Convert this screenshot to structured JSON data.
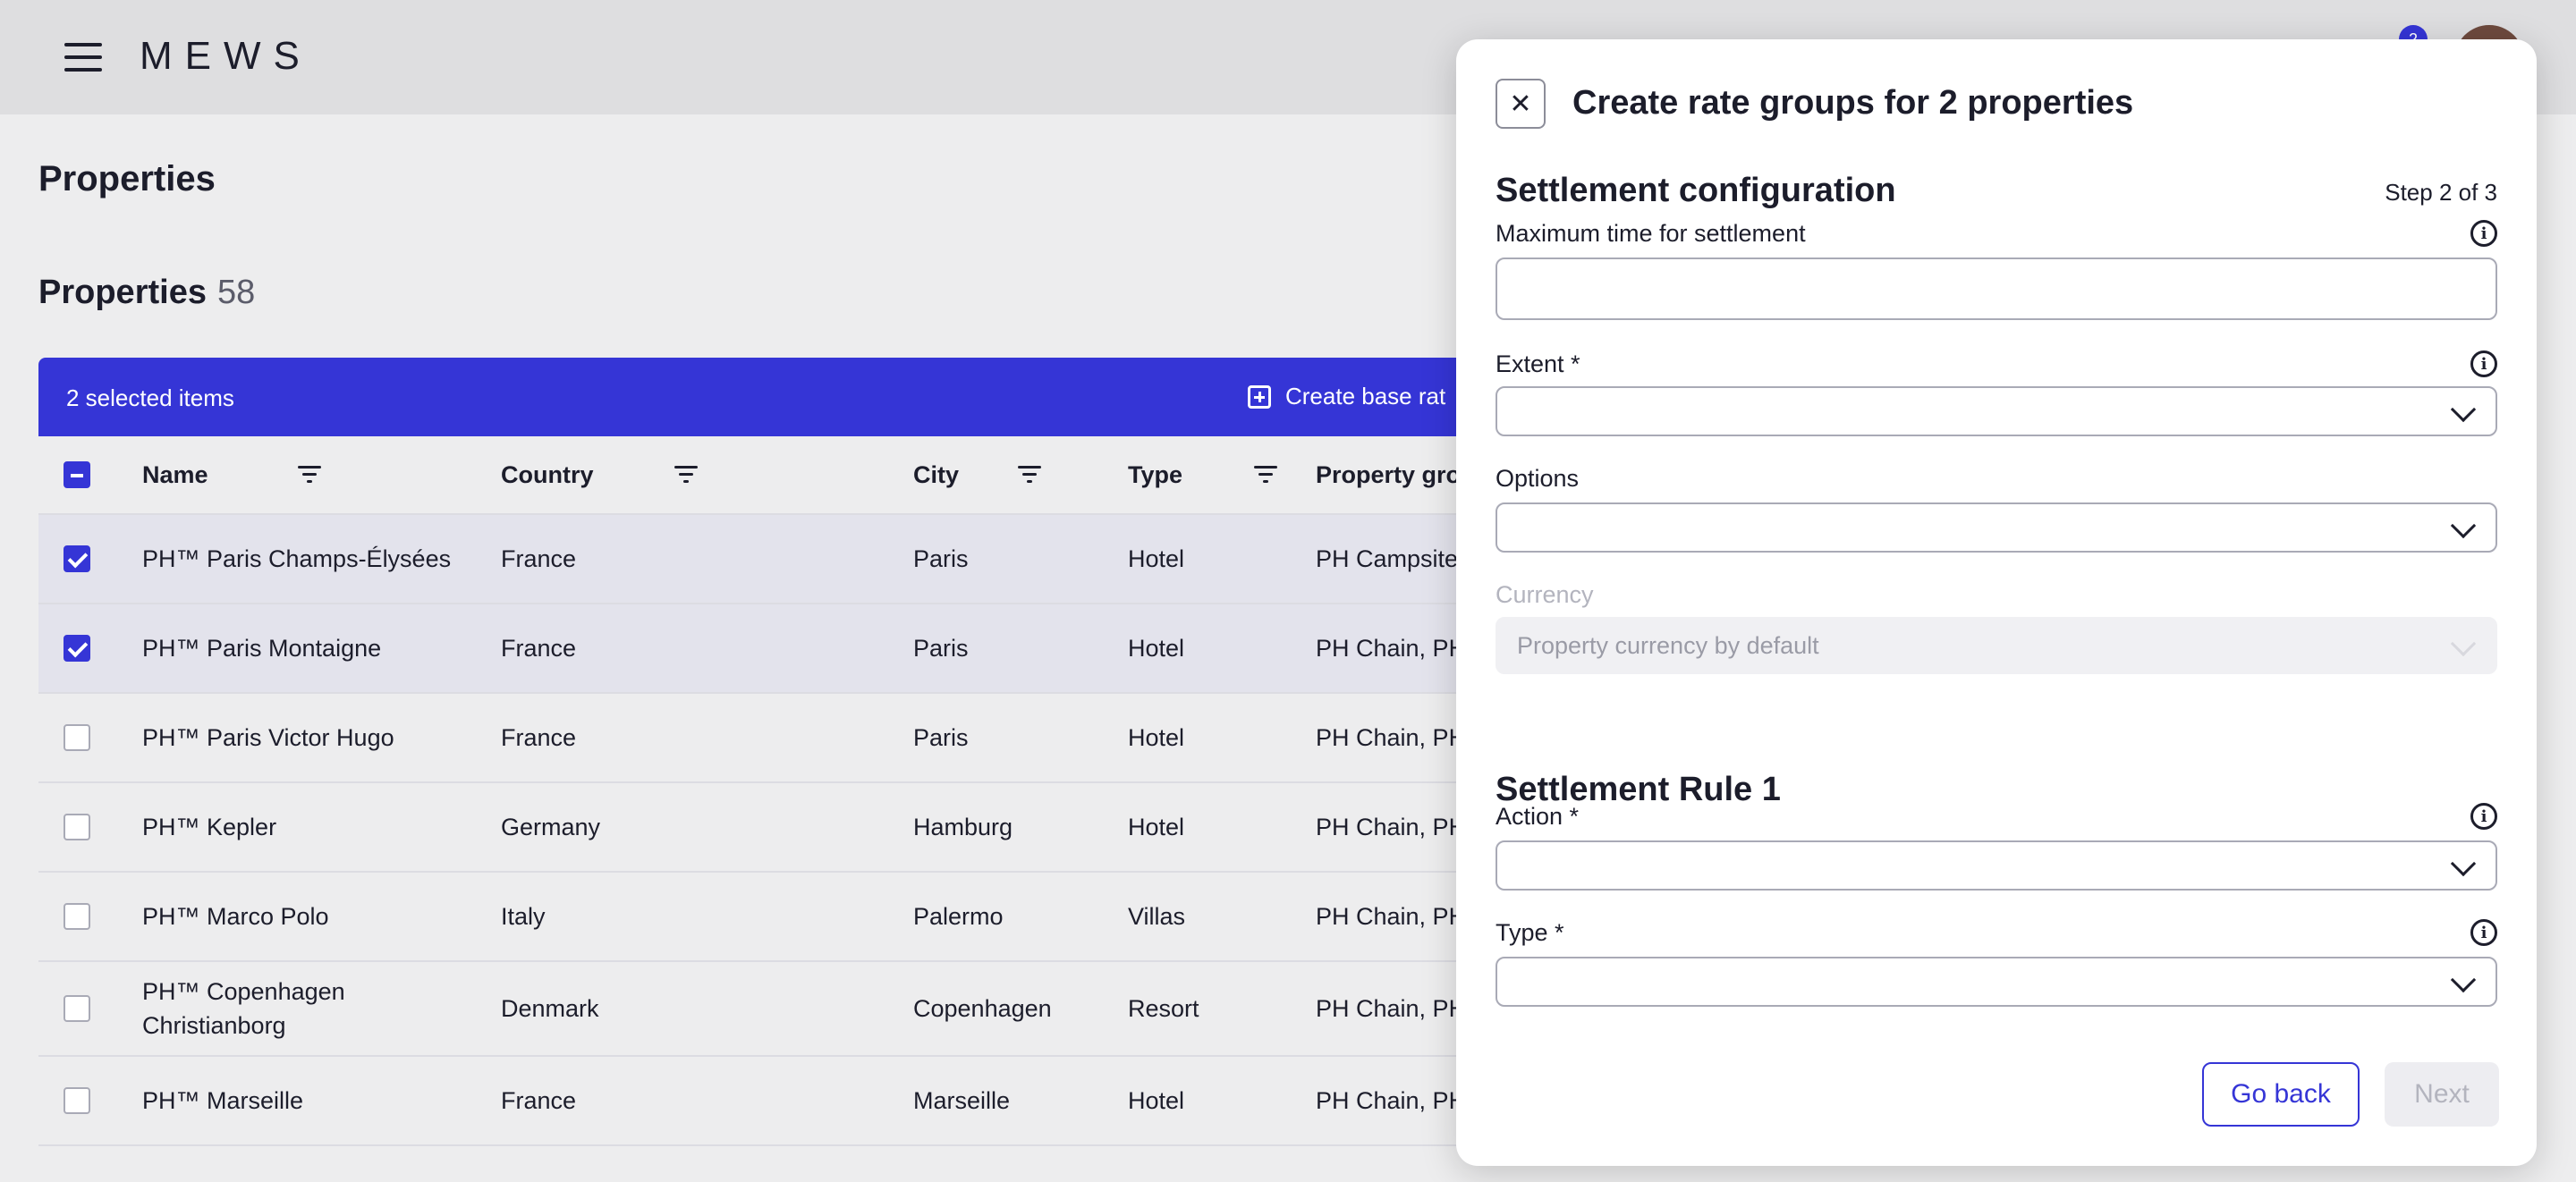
{
  "app": {
    "logo": "MEWS",
    "notification_count": "2"
  },
  "page": {
    "title": "Properties",
    "section_title": "Properties",
    "section_count": "58"
  },
  "selection_bar": {
    "selected_text": "2 selected items",
    "create_label": "Create base rat"
  },
  "table": {
    "headers": {
      "name": "Name",
      "country": "Country",
      "city": "City",
      "type": "Type",
      "group": "Property grou"
    },
    "rows": [
      {
        "name": "PH™ Paris Champs-Élysées",
        "country": "France",
        "city": "Paris",
        "type": "Hotel",
        "group": "PH Campsite",
        "selected": true
      },
      {
        "name": "PH™ Paris Montaigne",
        "country": "France",
        "city": "Paris",
        "type": "Hotel",
        "group": "PH Chain, PH",
        "selected": true
      },
      {
        "name": "PH™ Paris Victor Hugo",
        "country": "France",
        "city": "Paris",
        "type": "Hotel",
        "group": "PH Chain, PH",
        "selected": false
      },
      {
        "name": "PH™ Kepler",
        "country": "Germany",
        "city": "Hamburg",
        "type": "Hotel",
        "group": "PH Chain, PH",
        "selected": false
      },
      {
        "name": "PH™ Marco Polo",
        "country": "Italy",
        "city": "Palermo",
        "type": "Villas",
        "group": "PH Chain, PH",
        "selected": false
      },
      {
        "name": "PH™ Copenhagen Christianborg",
        "country": "Denmark",
        "city": "Copenhagen",
        "type": "Resort",
        "group": "PH Chain, PH",
        "selected": false
      },
      {
        "name": "PH™ Marseille",
        "country": "France",
        "city": "Marseille",
        "type": "Hotel",
        "group": "PH Chain, PH",
        "selected": false
      }
    ]
  },
  "modal": {
    "title": "Create rate groups for 2 properties",
    "close_icon": "close-icon",
    "step_title": "Settlement configuration",
    "step_count": "Step 2 of 3",
    "fields": {
      "max_time_label": "Maximum time for settlement",
      "max_time_value": "",
      "extent_label": "Extent *",
      "options_label": "Options",
      "currency_label": "Currency",
      "currency_value": "Property currency by default"
    },
    "rule": {
      "title": "Settlement Rule 1",
      "action_label": "Action *",
      "type_label": "Type *"
    },
    "buttons": {
      "go_back": "Go back",
      "next": "Next"
    },
    "info_icon": "ⓘ"
  },
  "colors": {
    "accent": "#3535d6",
    "row_selected": "#e3e3ec",
    "topbar": "#dedee0"
  }
}
